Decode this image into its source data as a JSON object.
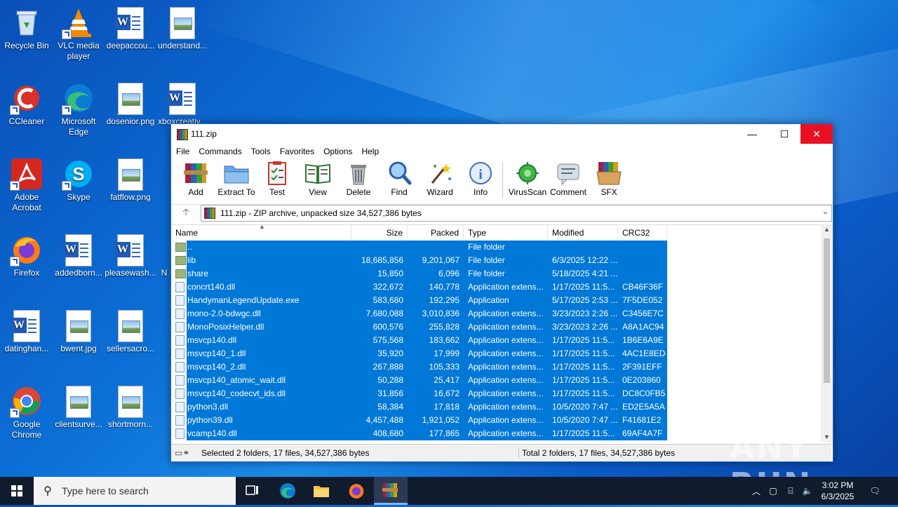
{
  "desktop": {
    "icons": [
      {
        "label": "Recycle Bin"
      },
      {
        "label": "VLC media player"
      },
      {
        "label": "deepaccou..."
      },
      {
        "label": "understand..."
      },
      {
        "label": "CCleaner"
      },
      {
        "label": "Microsoft Edge"
      },
      {
        "label": "dosenior.png"
      },
      {
        "label": "xboxcreativ..."
      },
      {
        "label": "Adobe Acrobat"
      },
      {
        "label": "Skype"
      },
      {
        "label": "fatflow.png"
      },
      {
        "label": "Firefox"
      },
      {
        "label": "addedborn..."
      },
      {
        "label": "pleasewash..."
      },
      {
        "label": "N"
      },
      {
        "label": "datinghan..."
      },
      {
        "label": "bwent.jpg"
      },
      {
        "label": "sellersacro..."
      },
      {
        "label": "Google Chrome"
      },
      {
        "label": "clientsurve..."
      },
      {
        "label": "shortmorn..."
      }
    ]
  },
  "window": {
    "title": "111.zip",
    "controls": {
      "minimize": "—",
      "maximize": "☐",
      "close": "✕"
    },
    "menu": [
      "File",
      "Commands",
      "Tools",
      "Favorites",
      "Options",
      "Help"
    ],
    "toolbar": [
      "Add",
      "Extract To",
      "Test",
      "View",
      "Delete",
      "Find",
      "Wizard",
      "Info",
      "VirusScan",
      "Comment",
      "SFX"
    ],
    "address": "111.zip - ZIP archive, unpacked size 34,527,386 bytes",
    "columns": {
      "name": "Name",
      "size": "Size",
      "packed": "Packed",
      "type": "Type",
      "modified": "Modified",
      "crc": "CRC32"
    },
    "files": [
      {
        "name": "..",
        "size": "",
        "packed": "",
        "type": "File folder",
        "modified": "",
        "crc": "",
        "kind": "folder"
      },
      {
        "name": "lib",
        "size": "18,685,856",
        "packed": "9,201,067",
        "type": "File folder",
        "modified": "6/3/2025 12:22 ...",
        "crc": "",
        "kind": "folder"
      },
      {
        "name": "share",
        "size": "15,850",
        "packed": "6,096",
        "type": "File folder",
        "modified": "5/18/2025 4:21 ...",
        "crc": "",
        "kind": "folder"
      },
      {
        "name": "concrt140.dll",
        "size": "322,672",
        "packed": "140,778",
        "type": "Application extens...",
        "modified": "1/17/2025 11:5...",
        "crc": "CB46F36F",
        "kind": "file"
      },
      {
        "name": "HandymanLegendUpdate.exe",
        "size": "583,680",
        "packed": "192,295",
        "type": "Application",
        "modified": "5/17/2025 2:53 ...",
        "crc": "7F5DE052",
        "kind": "exe"
      },
      {
        "name": "mono-2.0-bdwgc.dll",
        "size": "7,680,088",
        "packed": "3,010,836",
        "type": "Application extens...",
        "modified": "3/23/2023 2:26 ...",
        "crc": "C3456E7C",
        "kind": "file"
      },
      {
        "name": "MonoPosixHelper.dll",
        "size": "600,576",
        "packed": "255,828",
        "type": "Application extens...",
        "modified": "3/23/2023 2:26 ...",
        "crc": "A8A1AC94",
        "kind": "file"
      },
      {
        "name": "msvcp140.dll",
        "size": "575,568",
        "packed": "183,662",
        "type": "Application extens...",
        "modified": "1/17/2025 11:5...",
        "crc": "1B6E6A9E",
        "kind": "file"
      },
      {
        "name": "msvcp140_1.dll",
        "size": "35,920",
        "packed": "17,999",
        "type": "Application extens...",
        "modified": "1/17/2025 11:5...",
        "crc": "4AC1E8ED",
        "kind": "file"
      },
      {
        "name": "msvcp140_2.dll",
        "size": "267,888",
        "packed": "105,333",
        "type": "Application extens...",
        "modified": "1/17/2025 11:5...",
        "crc": "2F391EFF",
        "kind": "file"
      },
      {
        "name": "msvcp140_atomic_wait.dll",
        "size": "50,288",
        "packed": "25,417",
        "type": "Application extens...",
        "modified": "1/17/2025 11:5...",
        "crc": "0E203860",
        "kind": "file"
      },
      {
        "name": "msvcp140_codecvt_ids.dll",
        "size": "31,856",
        "packed": "16,672",
        "type": "Application extens...",
        "modified": "1/17/2025 11:5...",
        "crc": "DC8C0FB5",
        "kind": "file"
      },
      {
        "name": "python3.dll",
        "size": "58,384",
        "packed": "17,818",
        "type": "Application extens...",
        "modified": "10/5/2020 7:47 ...",
        "crc": "ED2E5A5A",
        "kind": "file"
      },
      {
        "name": "python39.dll",
        "size": "4,457,488",
        "packed": "1,921,052",
        "type": "Application extens...",
        "modified": "10/5/2020 7:47 ...",
        "crc": "F41681E2",
        "kind": "file"
      },
      {
        "name": "vcamp140.dll",
        "size": "408,680",
        "packed": "177,865",
        "type": "Application extens...",
        "modified": "1/17/2025 11:5...",
        "crc": "69AF4A7F",
        "kind": "file"
      }
    ],
    "status_left": "Selected 2 folders, 17 files, 34,527,386 bytes",
    "status_right": "Total 2 folders, 17 files, 34,527,386 bytes"
  },
  "taskbar": {
    "search_placeholder": "Type here to search",
    "time": "3:02 PM",
    "date": "6/3/2025"
  },
  "watermark": "ANY RUN",
  "colors": {
    "selection": "#0078d7",
    "close_hover": "#e81123",
    "taskbar": "#101b2d"
  }
}
